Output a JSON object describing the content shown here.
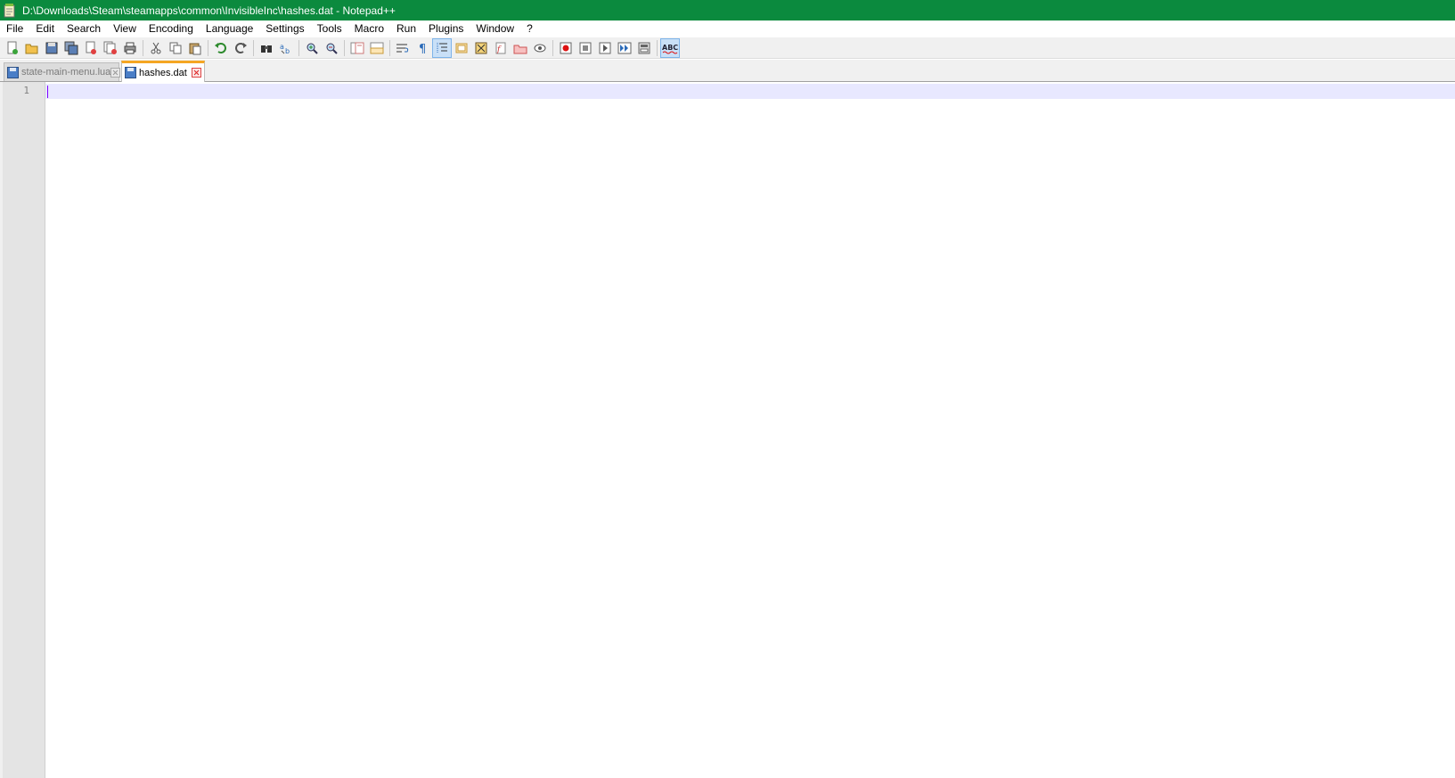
{
  "window": {
    "title": "D:\\Downloads\\Steam\\steamapps\\common\\InvisibleInc\\hashes.dat - Notepad++",
    "titlebar_color": "#0b8a3e"
  },
  "menu": {
    "items": [
      "File",
      "Edit",
      "Search",
      "View",
      "Encoding",
      "Language",
      "Settings",
      "Tools",
      "Macro",
      "Run",
      "Plugins",
      "Window",
      "?"
    ]
  },
  "toolbar": {
    "buttons": [
      "new-file-icon",
      "open-file-icon",
      "save-icon",
      "save-all-icon",
      "close-icon",
      "close-all-icon",
      "print-icon",
      "cut-icon",
      "copy-icon",
      "paste-icon",
      "undo-icon",
      "redo-icon",
      "find-icon",
      "replace-icon",
      "zoom-in-icon",
      "zoom-out-icon",
      "sync-vertical-icon",
      "sync-horizontal-icon",
      "word-wrap-icon",
      "show-all-chars-icon",
      "indent-guide-icon",
      "udl-icon",
      "doc-map-icon",
      "function-list-icon",
      "folder-workspace-icon",
      "monitoring-icon",
      "record-macro-icon",
      "stop-recording-icon",
      "play-macro-icon",
      "run-macro-multiple-icon",
      "save-macro-icon",
      "spell-check-icon"
    ]
  },
  "tabs": [
    {
      "label": "state-main-menu.lua",
      "active": false
    },
    {
      "label": "hashes.dat",
      "active": true
    }
  ],
  "editor": {
    "line_numbers": [
      "1"
    ],
    "current_line_color": "#e8e8ff",
    "caret_color": "#8000ff"
  }
}
